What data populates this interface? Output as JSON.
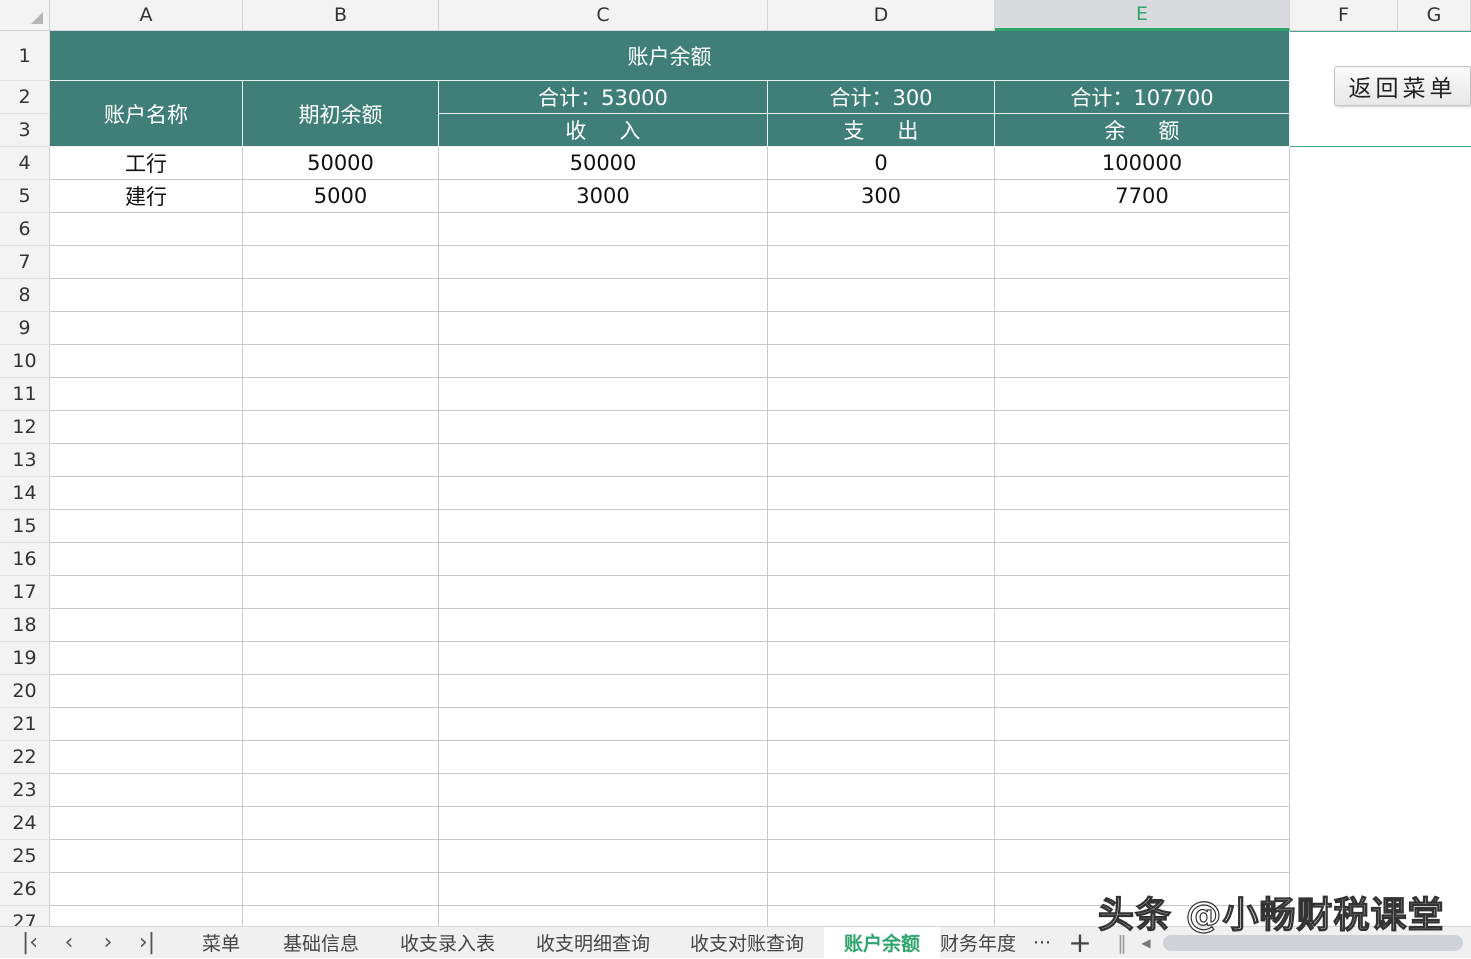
{
  "columns": [
    "A",
    "B",
    "C",
    "D",
    "E",
    "F",
    "G"
  ],
  "selected_column": "E",
  "row_numbers": [
    "1",
    "2",
    "3",
    "4",
    "5",
    "6",
    "7",
    "8",
    "9",
    "10",
    "11",
    "12",
    "13",
    "14",
    "15",
    "16",
    "17",
    "18",
    "19",
    "20",
    "21",
    "22",
    "23",
    "24",
    "25",
    "26",
    "27"
  ],
  "sheet": {
    "title": "账户余额",
    "header_account": "账户名称",
    "header_opening": "期初余额",
    "total_income": "合计：53000",
    "total_expense": "合计：300",
    "total_balance": "合计：107700",
    "header_income": "收 入",
    "header_expense": "支 出",
    "header_balance": "余 额",
    "rows": [
      {
        "account": "工行",
        "opening": "50000",
        "income": "50000",
        "expense": "0",
        "balance": "100000"
      },
      {
        "account": "建行",
        "opening": "5000",
        "income": "3000",
        "expense": "300",
        "balance": "7700"
      }
    ]
  },
  "button": {
    "return_menu": "返回菜单"
  },
  "tabs": [
    "菜单",
    "基础信息",
    "收支录入表",
    "收支明细查询",
    "收支对账查询",
    "账户余额",
    "财务年度"
  ],
  "active_tab": "账户余额",
  "tab_more": "···",
  "tab_add": "+",
  "watermark": "头条 @小畅财税课堂",
  "colors": {
    "header_fill": "#3f7f78",
    "accent": "#2fa56e"
  }
}
